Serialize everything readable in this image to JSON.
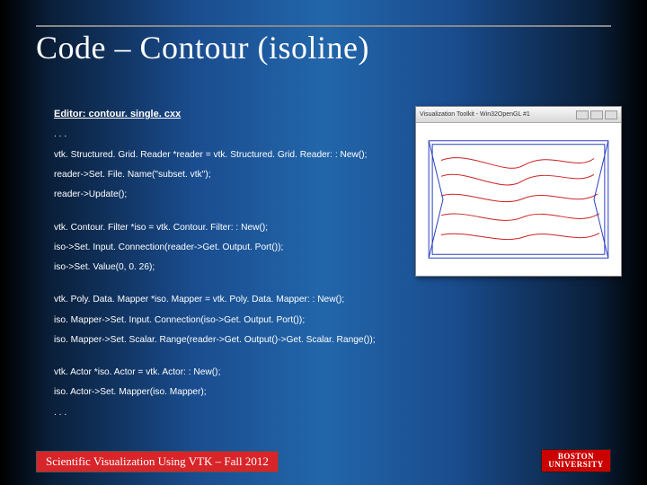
{
  "title": "Code – Contour (isoline)",
  "editor_label": "Editor:  contour. single. cxx",
  "code": {
    "l0": ". . .",
    "l1": "vtk. Structured. Grid. Reader *reader = vtk. Structured. Grid. Reader: : New();",
    "l2": "reader->Set. File. Name(\"subset. vtk\");",
    "l3": "reader->Update();",
    "l4": "vtk. Contour. Filter *iso = vtk. Contour. Filter: : New();",
    "l5": "iso->Set. Input. Connection(reader->Get. Output. Port());",
    "l6": "iso->Set. Value(0, 0. 26);",
    "l7": "vtk. Poly. Data. Mapper *iso. Mapper = vtk. Poly. Data. Mapper: : New();",
    "l8": "iso. Mapper->Set. Input. Connection(iso->Get. Output. Port());",
    "l9": "iso. Mapper->Set. Scalar. Range(reader->Get. Output()->Get. Scalar. Range());",
    "l10": "vtk. Actor *iso. Actor = vtk. Actor: : New();",
    "l11": "iso. Actor->Set. Mapper(iso. Mapper);",
    "l12": ". . ."
  },
  "viz_window_title": "Visualization Toolkit - Win32OpenGL #1",
  "footer_text": "Scientific Visualization Using VTK – Fall 2012",
  "logo_text": "BOSTON UNIVERSITY"
}
